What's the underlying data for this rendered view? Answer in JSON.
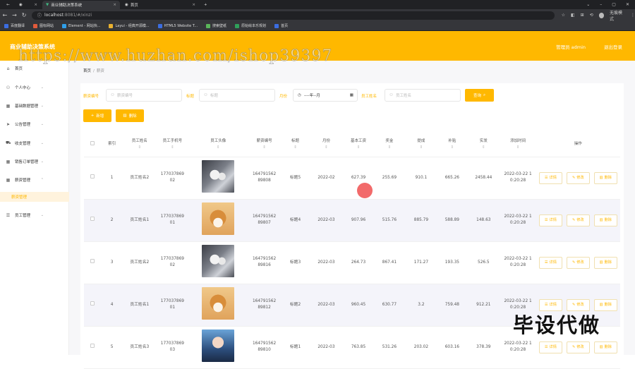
{
  "browser": {
    "tabs": [
      {
        "title": "商业辅助决策系统",
        "active": true
      },
      {
        "title": "首页",
        "active": false
      }
    ],
    "url_host": "localhost",
    "url_path": ":8081/#/xinzi",
    "profile_label": "无痕模式",
    "bookmarks": [
      "百度翻译",
      "图标网站",
      "Element - 网站快...",
      "Layui - 经典开源模...",
      "HTML5 Website T...",
      "搜索壁纸",
      "原始绘本乐规划",
      "首页"
    ]
  },
  "header": {
    "app_title": "商业辅助决策系统",
    "user_label": "管理员 admin",
    "logout_label": "退出登录",
    "watermark": "https://www.huzhan.com/ishop39397"
  },
  "sidebar": {
    "items": [
      {
        "label": "首页",
        "icon": "home-icon"
      },
      {
        "label": "个人中心",
        "icon": "user-icon"
      },
      {
        "label": "基础数据管理",
        "icon": "grid-icon"
      },
      {
        "label": "公告管理",
        "icon": "send-icon"
      },
      {
        "label": "收支管理",
        "icon": "cart-icon"
      },
      {
        "label": "销售订单管理",
        "icon": "grid-icon"
      },
      {
        "label": "薪资管理",
        "icon": "grid-icon"
      },
      {
        "label": "薪资管理",
        "icon": "",
        "sub": true
      },
      {
        "label": "员工管理",
        "icon": "list-icon"
      }
    ]
  },
  "breadcrumb": {
    "home": "首页",
    "current": "薪资"
  },
  "filters": {
    "code_label": "薪资编号",
    "code_placeholder": "薪资编号",
    "title_label": "标题",
    "title_placeholder": "标题",
    "month_label": "月份",
    "month_placeholder": "----年--月",
    "name_label": "员工姓名",
    "name_placeholder": "员工姓名",
    "search_label": "查询"
  },
  "actions": {
    "add_label": "新增",
    "delete_label": "删除"
  },
  "table": {
    "columns": [
      "索引",
      "员工姓名",
      "员工手机号",
      "员工头像",
      "薪资编号",
      "标题",
      "月份",
      "基本工资",
      "奖金",
      "提成",
      "补贴",
      "实发",
      "添加时间",
      "操作"
    ],
    "ops": {
      "detail": "详情",
      "edit": "修改",
      "delete": "删除"
    },
    "rows": [
      {
        "index": "1",
        "name": "员工姓名2",
        "phone": "17703786902",
        "avatar": "husky",
        "code": "16479156289808",
        "title": "标题5",
        "month": "2022-02",
        "base": "627.39",
        "bonus": "255.69",
        "commission": "910.1",
        "subsidy": "665.26",
        "paid": "2458.44",
        "time": "2022-03-22 10:20:28"
      },
      {
        "index": "2",
        "name": "员工姓名1",
        "phone": "17703786901",
        "avatar": "shiba",
        "code": "16479156289807",
        "title": "标题4",
        "month": "2022-03",
        "base": "907.96",
        "bonus": "515.76",
        "commission": "885.79",
        "subsidy": "588.89",
        "paid": "148.63",
        "time": "2022-03-22 10:20:28"
      },
      {
        "index": "3",
        "name": "员工姓名2",
        "phone": "17703786902",
        "avatar": "husky",
        "code": "16479156289816",
        "title": "标题3",
        "month": "2022-03",
        "base": "264.73",
        "bonus": "867.41",
        "commission": "171.27",
        "subsidy": "193.35",
        "paid": "526.5",
        "time": "2022-03-22 10:20:28"
      },
      {
        "index": "4",
        "name": "员工姓名1",
        "phone": "17703786901",
        "avatar": "shiba",
        "code": "16479156289812",
        "title": "标题2",
        "month": "2022-03",
        "base": "960.45",
        "bonus": "630.77",
        "commission": "3.2",
        "subsidy": "759.48",
        "paid": "912.21",
        "time": "2022-03-22 10:20:28"
      },
      {
        "index": "5",
        "name": "员工姓名3",
        "phone": "17703786903",
        "avatar": "person",
        "code": "16479156289810",
        "title": "标题1",
        "month": "2022-03",
        "base": "763.85",
        "bonus": "531.26",
        "commission": "203.02",
        "subsidy": "603.16",
        "paid": "378.39",
        "time": "2022-03-22 10:20:28"
      }
    ]
  },
  "overlay_text": "毕设代做",
  "colors": {
    "accent": "#ffb800",
    "stripe": "#f4f4fa"
  }
}
